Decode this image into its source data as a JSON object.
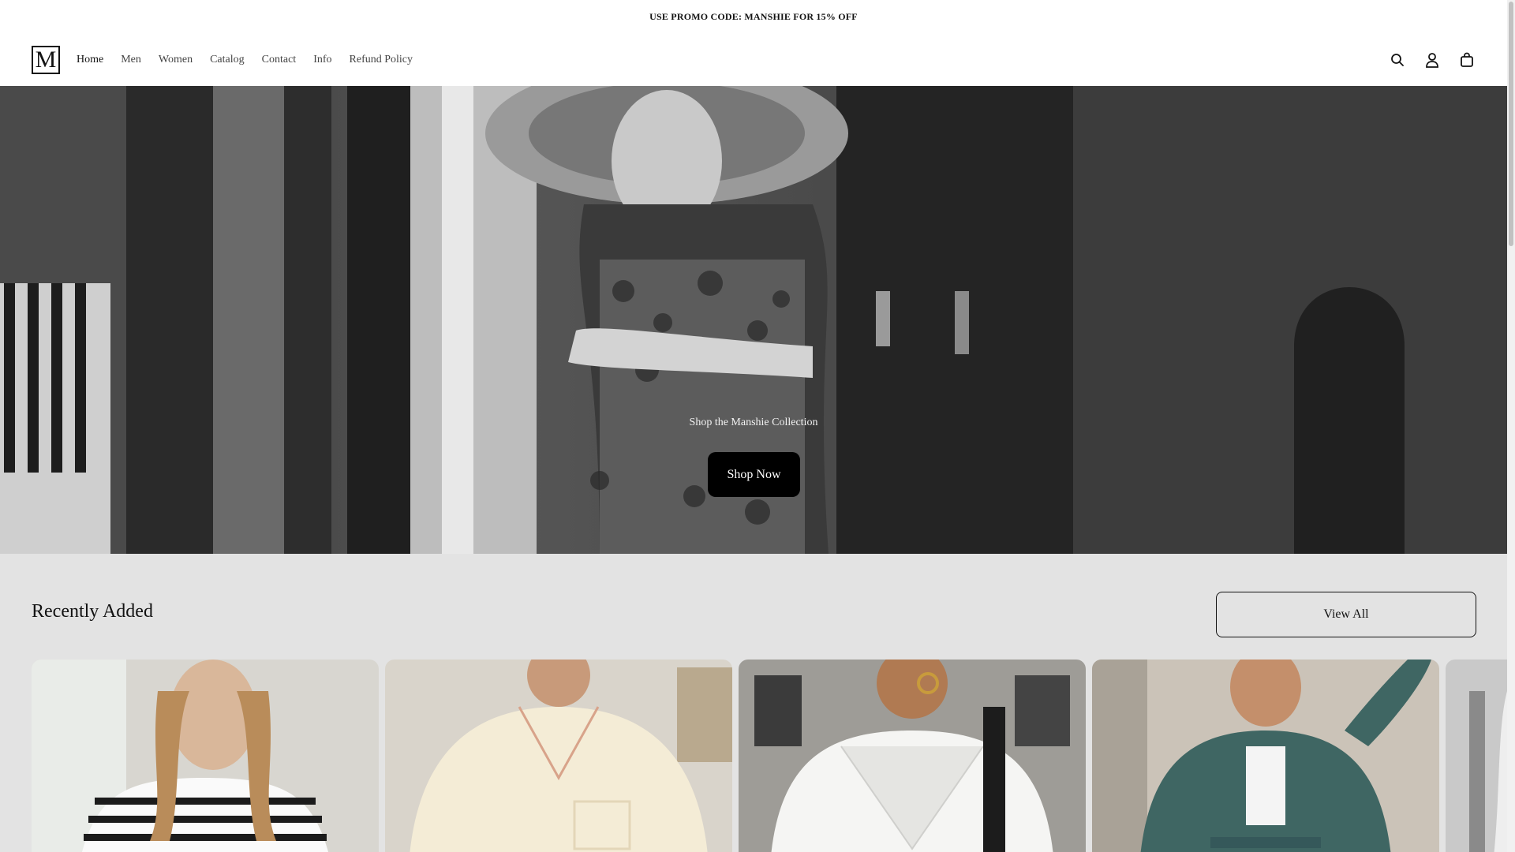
{
  "promo": {
    "text": "USE PROMO CODE: MANSHIE FOR 15% OFF"
  },
  "header": {
    "logo_letter": "M",
    "nav": [
      {
        "label": "Home",
        "active": true
      },
      {
        "label": "Men"
      },
      {
        "label": "Women"
      },
      {
        "label": "Catalog"
      },
      {
        "label": "Contact"
      },
      {
        "label": "Info"
      },
      {
        "label": "Refund Policy"
      }
    ],
    "icons": [
      "search-icon",
      "account-icon",
      "cart-icon"
    ]
  },
  "hero": {
    "caption": "Shop the Manshie Collection",
    "button_label": "Shop Now"
  },
  "collection": {
    "title": "Recently Added",
    "view_all_label": "View All",
    "products": [
      {
        "description": "striped long sleeve top"
      },
      {
        "description": "cream pajama shirt"
      },
      {
        "description": "white trench coat"
      },
      {
        "description": "green button shirt dress"
      },
      {
        "description": "grey knit item"
      }
    ]
  },
  "colors": {
    "text": "#121212",
    "button_bg": "#000000",
    "section_bg": "#e3e3e3"
  }
}
